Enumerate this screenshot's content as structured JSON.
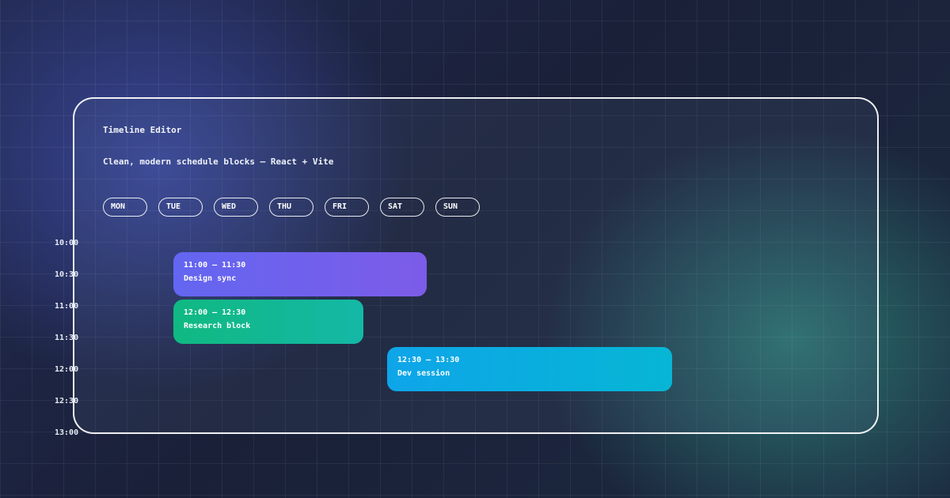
{
  "app": {
    "title": "Timeline Editor",
    "subtitle": "Clean, modern schedule blocks — React + Vite"
  },
  "days": [
    "MON",
    "TUE",
    "WED",
    "THU",
    "FRI",
    "SAT",
    "SUN"
  ],
  "time_labels": [
    "10:00",
    "10:30",
    "11:00",
    "11:30",
    "12:00",
    "12:30",
    "13:00"
  ],
  "events": [
    {
      "time": "11:00 – 11:30",
      "title": "Design sync",
      "color_start": "#6366f1",
      "color_end": "#7c5ce8"
    },
    {
      "time": "12:00 – 12:30",
      "title": "Research block",
      "color_start": "#10b981",
      "color_end": "#14b8a6"
    },
    {
      "time": "12:30 – 13:30",
      "title": "Dev session",
      "color_start": "#0ea5e9",
      "color_end": "#06b6d4"
    }
  ]
}
